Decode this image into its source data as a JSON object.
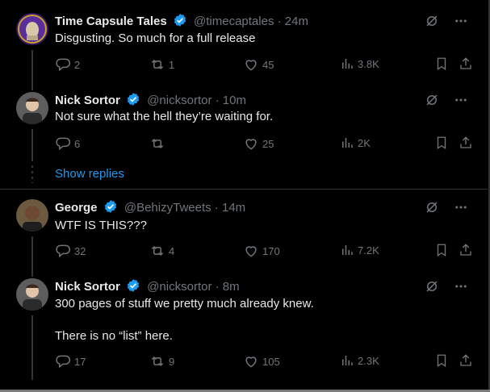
{
  "colors": {
    "accent": "#1d9bf0",
    "text": "#e7e9ea",
    "muted": "#71767b",
    "border": "#2f3336"
  },
  "tweets": [
    {
      "name": "Time Capsule Tales",
      "handle": "@timecaptales",
      "time": "24m",
      "text": "Disgusting. So much for a full release",
      "replies": "2",
      "reposts": "1",
      "likes": "45",
      "views": "3.8K"
    },
    {
      "name": "Nick Sortor",
      "handle": "@nicksortor",
      "time": "10m",
      "text": "Not sure what the hell they’re waiting for.",
      "replies": "6",
      "reposts": "",
      "likes": "25",
      "views": "2K"
    },
    {
      "name": "George",
      "handle": "@BehizyTweets",
      "time": "14m",
      "text": "WTF IS THIS???",
      "replies": "32",
      "reposts": "4",
      "likes": "170",
      "views": "7.2K"
    },
    {
      "name": "Nick Sortor",
      "handle": "@nicksortor",
      "time": "8m",
      "text": "300 pages of stuff we pretty much already knew.\n\nThere is no “list” here.",
      "replies": "17",
      "reposts": "9",
      "likes": "105",
      "views": "2.3K"
    }
  ],
  "show_replies": "Show replies",
  "separator": " · ",
  "icons": [
    "grok-icon",
    "more-icon",
    "reply-icon",
    "repost-icon",
    "like-icon",
    "views-icon",
    "bookmark-icon",
    "share-icon",
    "verified-icon"
  ]
}
